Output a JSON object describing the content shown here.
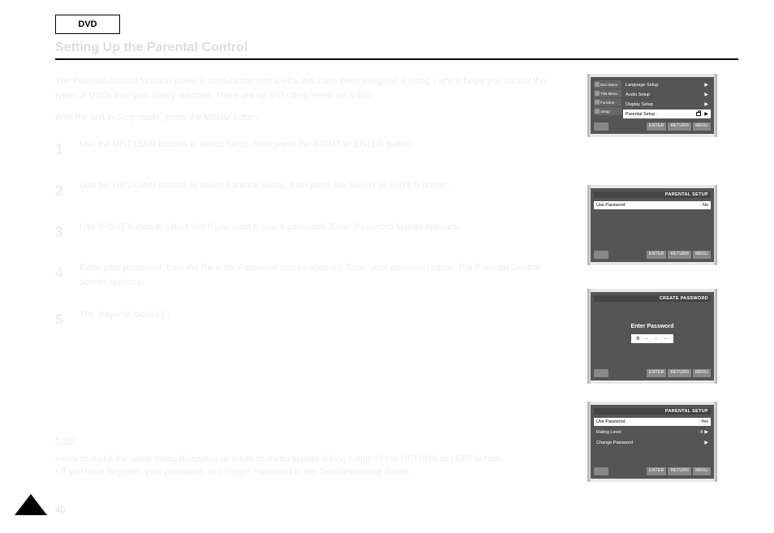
{
  "dvd_tab": "DVD",
  "section_title": "Setting Up the Parental Control",
  "intro": [
    "The Parental Control function works in conjunction with DVDs that have been assigned a rating - which helps you control the types of DVDs that your family watches. There are up to 8 rating levels on a disc.",
    "With the unit in Stop mode, press the MENU button."
  ],
  "steps": [
    {
      "num": "1",
      "text": "Use the UP/DOWN buttons to select Setup, then press the RIGHT or ENTER button."
    },
    {
      "num": "2",
      "text": "Use the UP/DOWN buttons to select Parental Setup, then press the RIGHT or ENTER button."
    },
    {
      "num": "3",
      "text": "Use RIGHT button to select Yes if you want to use a password. Enter Password screen appears."
    },
    {
      "num": "4",
      "text": "Enter your password, then the Re-enter Password screen appears. Enter your password again. The Parental Control screen appears."
    },
    {
      "num": "5",
      "text": "The player is locked ( )."
    }
  ],
  "note": {
    "header": "Note",
    "bullets": [
      "How to make the setup menu disappear or return to menu screen during setup; Press RETURN or LEFT button.",
      "If you have forgotten your password, see Forgot Password in the Troubleshooting Guide."
    ]
  },
  "page_number": "40",
  "screens": {
    "s1": {
      "left_items": [
        "Disc Menu",
        "Title Menu",
        "Function",
        "Setup"
      ],
      "right_items": [
        {
          "label": "Language Setup",
          "selected": false
        },
        {
          "label": "Audio Setup",
          "selected": false
        },
        {
          "label": "Display Setup",
          "selected": false
        },
        {
          "label": "Parental Setup :",
          "selected": true
        }
      ],
      "footer": [
        "ENTER",
        "RETURN",
        "MENU"
      ]
    },
    "s2": {
      "title": "PARENTAL SETUP",
      "row": {
        "label": "Use Password",
        "value": ": No"
      },
      "footer": [
        "ENTER",
        "RETURN",
        "MENU"
      ]
    },
    "s3": {
      "title": "CREATE PASSWORD",
      "prompt": "Enter Password",
      "mask": "0 - - -",
      "footer": [
        "ENTER",
        "RETURN",
        "MENU"
      ]
    },
    "s4": {
      "title": "PARENTAL SETUP",
      "rows": [
        {
          "label": "Use Password",
          "value": ": Yes",
          "selected": true
        },
        {
          "label": "Rating Level",
          "value": ": 8",
          "selected": false
        },
        {
          "label": "Change Password",
          "value": "",
          "selected": false
        }
      ],
      "footer": [
        "ENTER",
        "RETURN",
        "MENU"
      ]
    }
  }
}
